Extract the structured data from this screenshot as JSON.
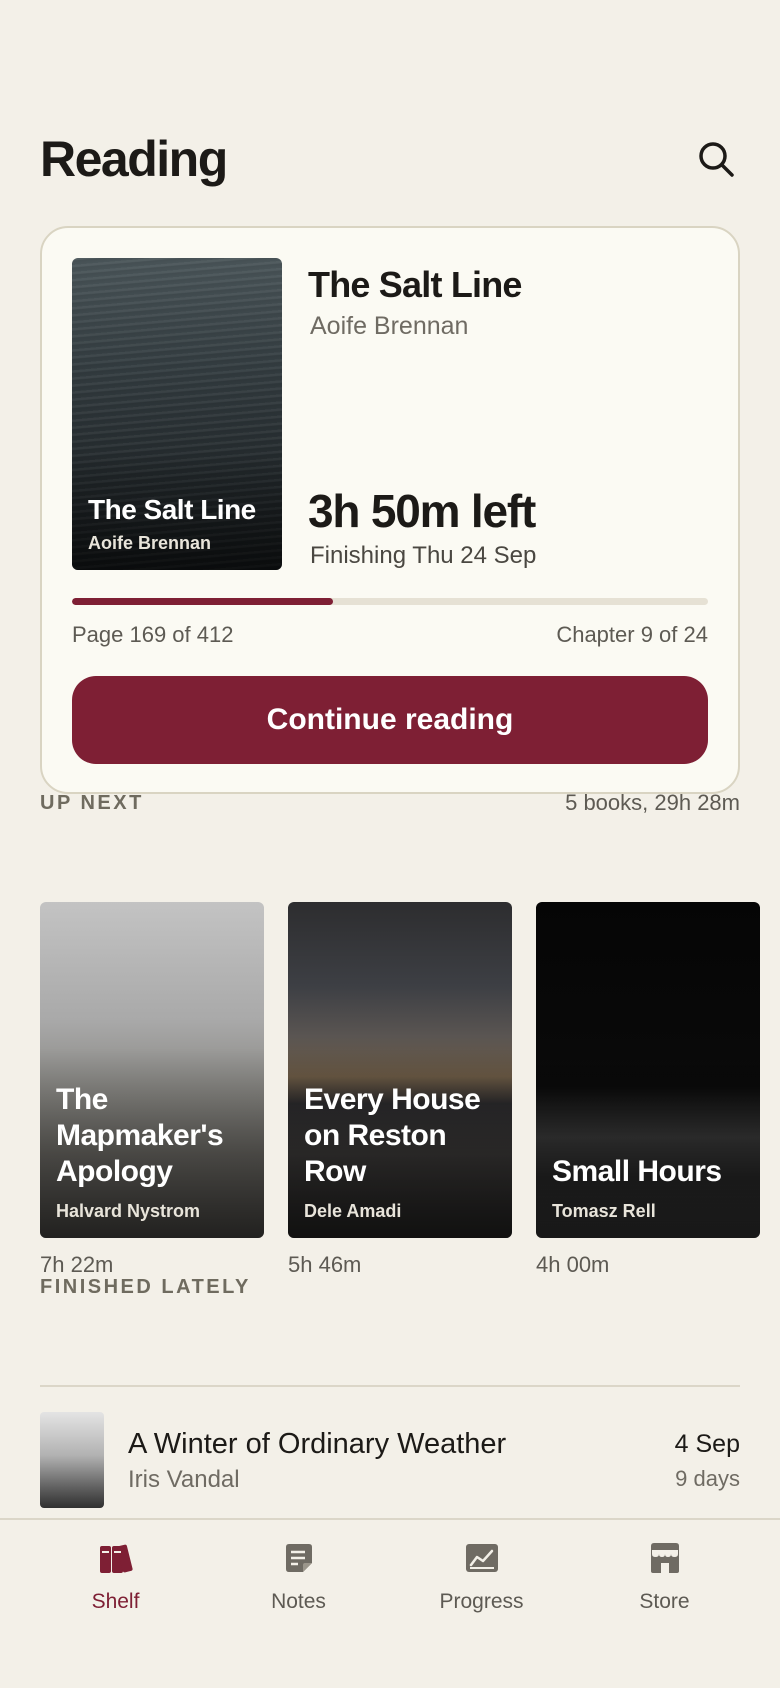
{
  "header": {
    "title": "Reading",
    "search_icon": "search-icon"
  },
  "current_book": {
    "cover_title": "The Salt Line",
    "cover_author": "Aoife Brennan",
    "title": "The Salt Line",
    "author": "Aoife Brennan",
    "time_left": "3h 50m left",
    "finishing": "Finishing Thu 24 Sep",
    "progress_fraction": 0.41,
    "page_info": "Page 169 of 412",
    "chapter_info": "Chapter 9 of 24",
    "continue_label": "Continue reading"
  },
  "up_next": {
    "label": "UP NEXT",
    "summary": "5 books, 29h 28m",
    "books": [
      {
        "title": "The Mapmaker's Apology",
        "author": "Halvard Nystrom",
        "duration": "7h 22m"
      },
      {
        "title": "Every House on Reston Row",
        "author": "Dele Amadi",
        "duration": "5h 46m"
      },
      {
        "title": "Small Hours",
        "author": "Tomasz Rell",
        "duration": "4h 00m"
      }
    ]
  },
  "finished": {
    "label": "FINISHED LATELY",
    "items": [
      {
        "title": "A Winter of Ordinary Weather",
        "author": "Iris Vandal",
        "date": "4 Sep",
        "days": "9 days"
      }
    ]
  },
  "tabbar": {
    "tabs": [
      {
        "label": "Shelf",
        "icon": "books-icon",
        "active": true
      },
      {
        "label": "Notes",
        "icon": "note-icon",
        "active": false
      },
      {
        "label": "Progress",
        "icon": "chart-icon",
        "active": false
      },
      {
        "label": "Store",
        "icon": "store-icon",
        "active": false
      }
    ]
  },
  "colors": {
    "accent": "#7e1f34",
    "background": "#f3f0e8",
    "card": "#fbfaf3"
  }
}
